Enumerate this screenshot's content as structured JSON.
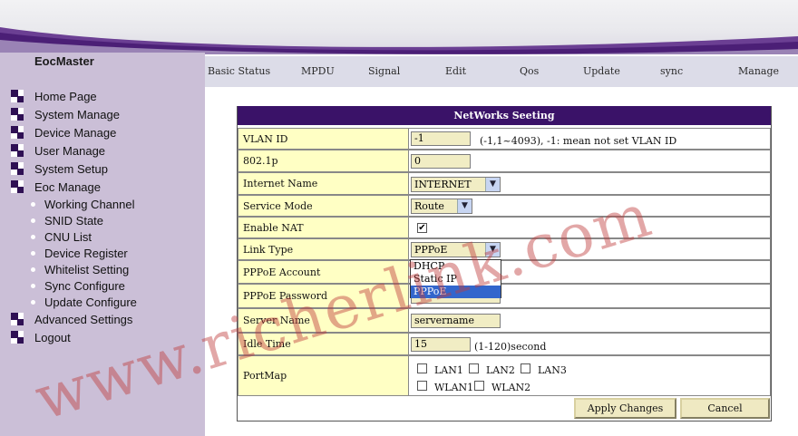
{
  "brand": "EocMaster",
  "left_menu": {
    "items": [
      {
        "label": "Home Page"
      },
      {
        "label": "System Manage"
      },
      {
        "label": "Device Manage"
      },
      {
        "label": "User Manage"
      },
      {
        "label": "System Setup"
      },
      {
        "label": "Eoc Manage"
      }
    ],
    "sub_items": [
      {
        "label": "Working Channel"
      },
      {
        "label": "SNID State"
      },
      {
        "label": "CNU List"
      },
      {
        "label": "Device Register"
      },
      {
        "label": "Whitelist Setting"
      },
      {
        "label": "Sync Configure"
      },
      {
        "label": "Update Configure"
      }
    ],
    "bottom_items": [
      {
        "label": "Advanced Settings"
      },
      {
        "label": "Logout"
      }
    ]
  },
  "top_nav": [
    "Basic Status",
    "MPDU",
    "Signal",
    "Edit",
    "Qos",
    "Update",
    "sync",
    "Manage"
  ],
  "form": {
    "title": "NetWorks Seeting",
    "vlan_id": {
      "label": "VLAN ID",
      "value": "-1",
      "hint": "(-1,1~4093), -1: mean not set VLAN ID"
    },
    "p8021": {
      "label": "802.1p",
      "value": "0"
    },
    "internet_name": {
      "label": "Internet Name",
      "value": "INTERNET"
    },
    "service_mode": {
      "label": "Service Mode",
      "value": "Route"
    },
    "enable_nat": {
      "label": "Enable NAT",
      "checked": true,
      "mark": "✔"
    },
    "link_type": {
      "label": "Link Type",
      "value": "PPPoE",
      "options": [
        "DHCP",
        "Static IP",
        "PPPoE"
      ]
    },
    "pppoe_account": {
      "label": "PPPoE Account"
    },
    "pppoe_password": {
      "label": "PPPoE Password"
    },
    "server_name": {
      "label": "Server Name",
      "value": "servername"
    },
    "idle_time": {
      "label": "Idle Time",
      "value": "15",
      "hint": "(1-120)second"
    },
    "portmap": {
      "label": "PortMap",
      "ports": [
        "LAN1",
        "LAN2",
        "LAN3",
        "WLAN1",
        "WLAN2"
      ]
    },
    "apply_label": "Apply Changes",
    "cancel_label": "Cancel"
  },
  "watermark": "www.richerlink.com",
  "colors": {
    "header_purple": "#3a1268",
    "sidebar": "#cbbfd7",
    "label_bg": "#ffffc4",
    "input_bg": "#f1edc4"
  }
}
